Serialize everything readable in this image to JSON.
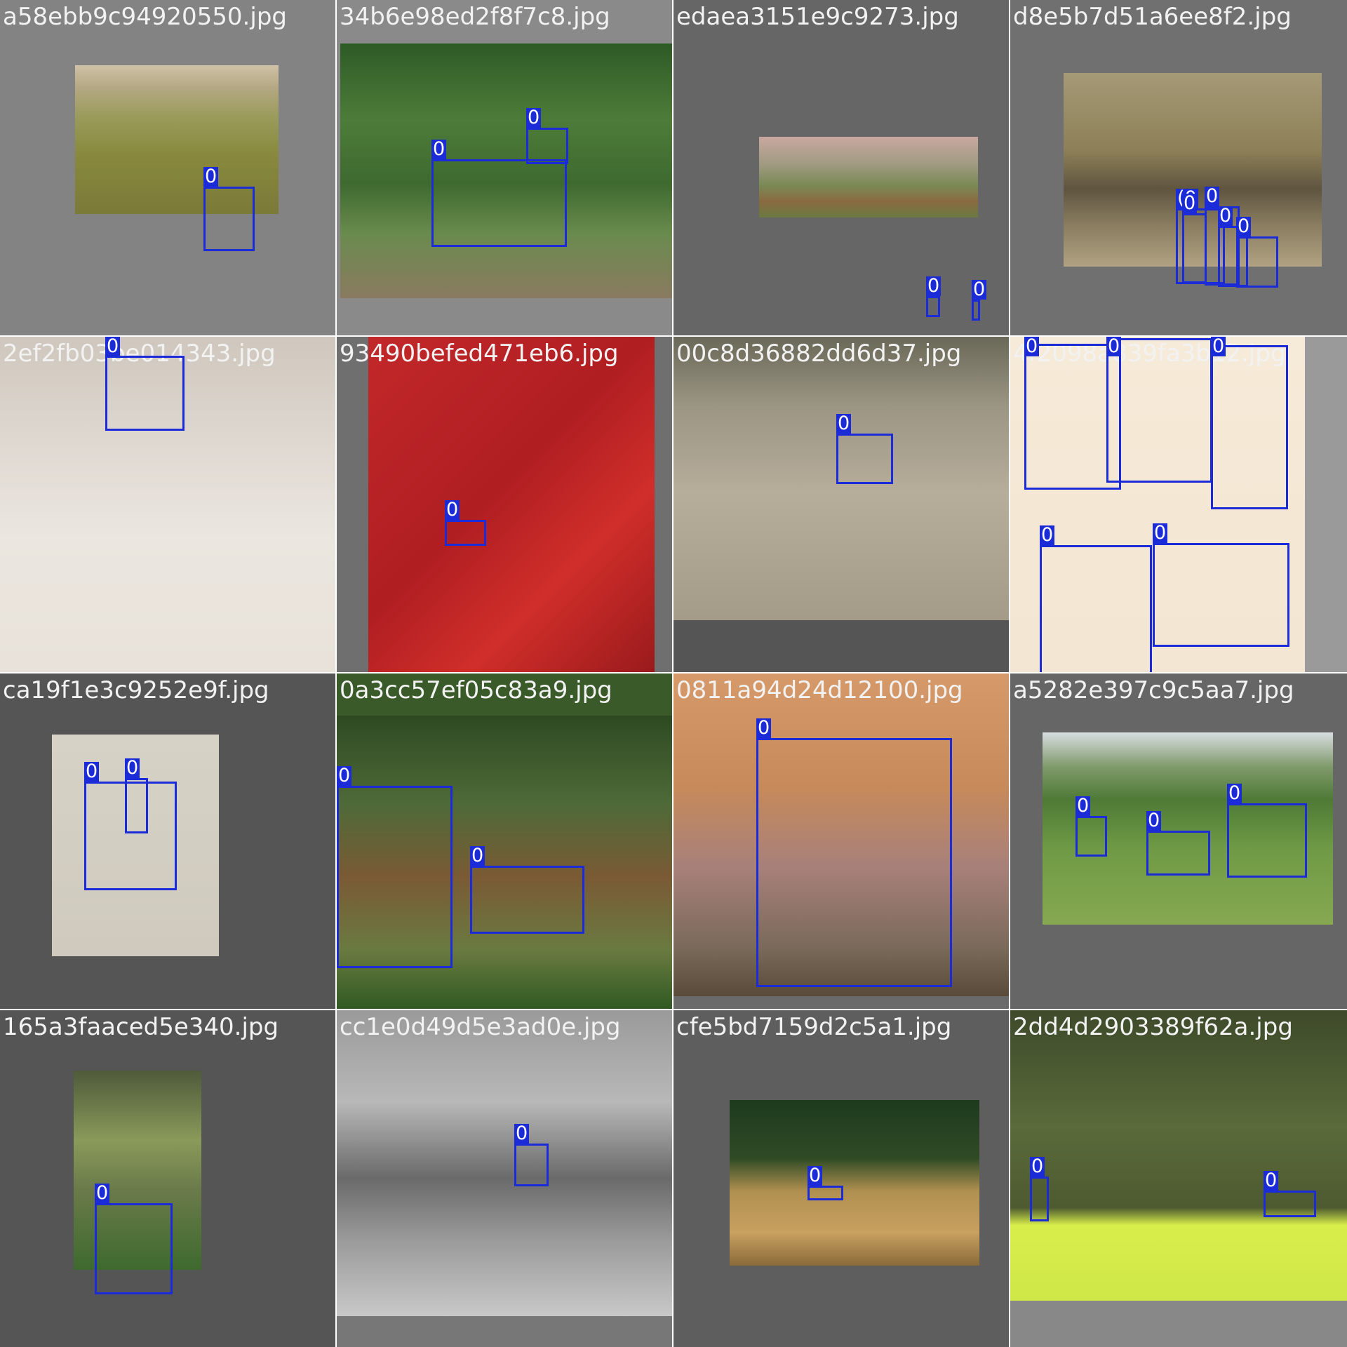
{
  "viewer": {
    "box_color": "#1c2bd8",
    "tiles": [
      {
        "filename": "a58ebb9c94920550.jpg",
        "background": "#838383",
        "gradient": "linear-gradient(180deg,#cfc2a6 0%,#b4a884 15%,#9a9b5a 35%,#88893e 60%,#7b7a38 100%)",
        "boxes": [
          {
            "label": "0"
          }
        ]
      },
      {
        "filename": "34b6e98ed2f8f7c8.jpg",
        "background": "#8a8a8a",
        "gradient": "linear-gradient(180deg,#2e5a26 0%,#4d7c39 30%,#3e6a2f 55%,#6a8b4e 75%,#8a7a60 100%)",
        "boxes": [
          {
            "label": "0"
          },
          {
            "label": "0"
          }
        ]
      },
      {
        "filename": "edaea3151e9c9273.jpg",
        "background": "#666666",
        "gradient": "linear-gradient(180deg,#c9a8a0 0%,#9f9a80 35%,#7a8a55 60%,#8a6a40 80%,#6a7a40 100%)",
        "boxes": [
          {
            "label": "0"
          },
          {
            "label": "0"
          }
        ]
      },
      {
        "filename": "d8e5b7d51a6ee8f2.jpg",
        "background": "#707070",
        "gradient": "linear-gradient(180deg,#a59a76 0%,#8d8058 40%,#5f5540 60%,#8d8062 80%,#b0a283 100%)",
        "boxes": [
          {
            "label": "(0"
          },
          {
            "label": "0"
          },
          {
            "label": "0"
          },
          {
            "label": "0"
          },
          {
            "label": "0"
          }
        ]
      },
      {
        "filename": "2ef2fb03be014343.jpg",
        "background": "#d9d6d1",
        "gradient": "linear-gradient(180deg,#cfc7bd 0%,#e0dad3 35%,#ebe6df 60%,#e8e2da 100%)",
        "boxes": [
          {
            "label": "0"
          }
        ]
      },
      {
        "filename": "93490befed471eb6.jpg",
        "background": "#6f6f6f",
        "gradient": "linear-gradient(135deg,#c2282a 0%,#b01e22 45%,#d02e2a 70%,#9a1a1c 100%)",
        "boxes": [
          {
            "label": "0"
          }
        ]
      },
      {
        "filename": "00c8d36882dd6d37.jpg",
        "background": "#555555",
        "gradient": "linear-gradient(180deg,#6a6858 0%,#9c9684 25%,#b6ad9a 55%,#a49b88 100%)",
        "boxes": [
          {
            "label": "0"
          }
        ]
      },
      {
        "filename": "4f2098a839fa3b12.jpg",
        "background": "#9a9a9a",
        "gradient": "linear-gradient(180deg,#f6ead8 0%,#f3e6d2 100%)",
        "boxes": [
          {
            "label": "0"
          },
          {
            "label": "0"
          },
          {
            "label": "0"
          },
          {
            "label": "0"
          },
          {
            "label": "0"
          }
        ]
      },
      {
        "filename": "ca19f1e3c9252e9f.jpg",
        "background": "#555555",
        "gradient": "linear-gradient(180deg,#d6d2c6 0%,#cfcabd 100%)",
        "boxes": [
          {
            "label": "0"
          },
          {
            "label": "0"
          }
        ]
      },
      {
        "filename": "0a3cc57ef05c83a9.jpg",
        "background": "#3a5a2a",
        "gradient": "linear-gradient(180deg,#2e4a22 0%,#4e6a38 30%,#7a5a35 55%,#6a7a40 80%,#2f5a22 100%)",
        "boxes": [
          {
            "label": "0"
          },
          {
            "label": "0"
          }
        ]
      },
      {
        "filename": "0811a94d24d12100.jpg",
        "background": "#6a6a6a",
        "gradient": "linear-gradient(180deg,#d69a6a 0%,#c78a5a 35%,#a7807a 60%,#7a6a5a 85%,#5a4a3a 100%)",
        "boxes": [
          {
            "label": "0"
          }
        ]
      },
      {
        "filename": "a5282e397c9c5aa7.jpg",
        "background": "#666666",
        "gradient": "linear-gradient(180deg,#d8dde0 0%,#7f9a6a 18%,#4e7a36 35%,#6f9a45 60%,#86a852 100%)",
        "boxes": [
          {
            "label": "0"
          },
          {
            "label": "0"
          },
          {
            "label": "0"
          }
        ]
      },
      {
        "filename": "165a3faaced5e340.jpg",
        "background": "#555555",
        "gradient": "linear-gradient(180deg,#4e5a3a 0%,#8a9a5a 35%,#6a7a4a 60%,#3e6a2e 100%)",
        "boxes": [
          {
            "label": "0"
          }
        ]
      },
      {
        "filename": "cc1e0d49d5e3ad0e.jpg",
        "background": "#777777",
        "gradient": "linear-gradient(180deg,#9a9a9a 0%,#b8b8b8 30%,#6a6a6a 55%,#9a9a9a 75%,#c8c8c8 100%)",
        "boxes": [
          {
            "label": "0"
          }
        ]
      },
      {
        "filename": "cfe5bd7159d2c5a1.jpg",
        "background": "#5e5e5e",
        "gradient": "linear-gradient(180deg,#1e3a1e 0%,#2e4a25 35%,#b09050 55%,#c8a060 80%,#8a6a3a 100%)",
        "boxes": [
          {
            "label": "0"
          }
        ]
      },
      {
        "filename": "2dd4d2903389f62a.jpg",
        "background": "#888888",
        "gradient": "linear-gradient(180deg,#3e4a2a 0%,#5a6a3a 40%,#4e5a30 68%,#d8ee4a 74%,#cfe848 100%)",
        "boxes": [
          {
            "label": "0"
          },
          {
            "label": "0"
          }
        ]
      }
    ]
  }
}
